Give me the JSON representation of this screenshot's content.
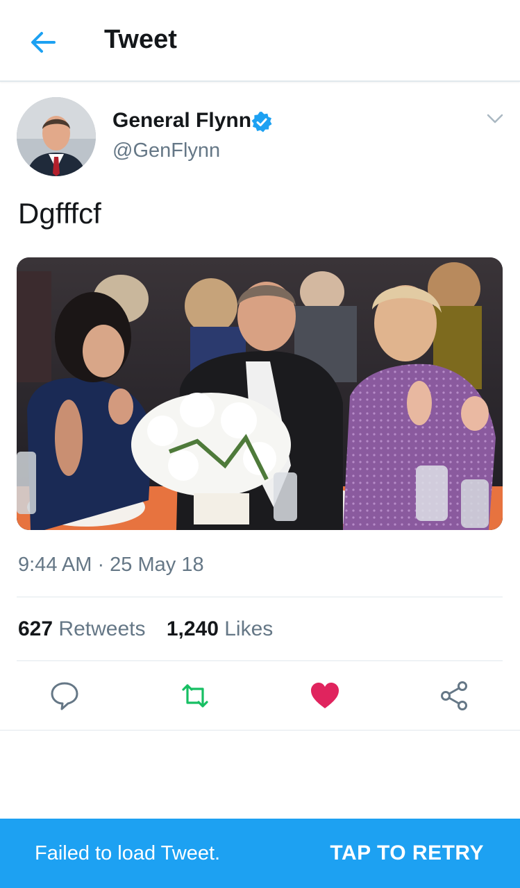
{
  "header": {
    "title": "Tweet"
  },
  "tweet": {
    "display_name": "General Flynn",
    "handle": "@GenFlynn",
    "text": "Dgfffcf",
    "timestamp": "9:44 AM · 25 May 18",
    "stats": {
      "retweets_count": "627",
      "retweets_label": "Retweets",
      "likes_count": "1,240",
      "likes_label": "Likes"
    }
  },
  "colors": {
    "accent": "#1da1f2",
    "retweet": "#17bf63",
    "like": "#e0245e",
    "secondary_text": "#657786"
  },
  "icons": {
    "back": "arrow-left-icon",
    "verified": "verified-badge-icon",
    "more": "chevron-down-icon",
    "reply": "reply-icon",
    "retweet": "retweet-icon",
    "like": "heart-icon",
    "share": "share-icon"
  },
  "snackbar": {
    "message": "Failed to load Tweet.",
    "action": "TAP TO RETRY"
  }
}
